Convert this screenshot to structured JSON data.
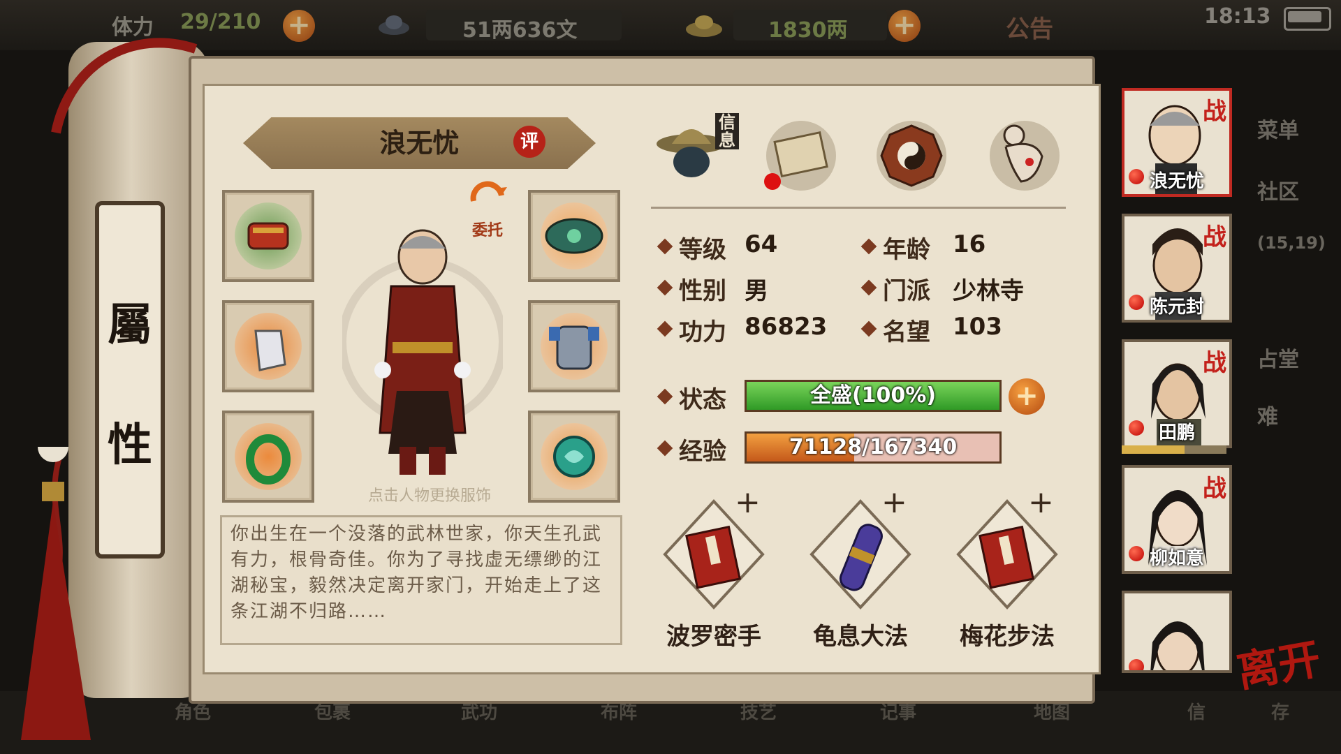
{
  "topbar": {
    "stamina_label": "体力",
    "stamina_value": "29/210",
    "silver": "51两636文",
    "gold": "1830两",
    "notice": "公告",
    "time": "18:13"
  },
  "scroll_tab": {
    "char1": "屬",
    "char2": "性"
  },
  "character": {
    "name": "浪无忧",
    "eval_badge": "评",
    "entrust": "委托",
    "hint": "点击人物更换服饰",
    "bio": "你出生在一个没落的武林世家，你天生孔武有力，根骨奇佳。你为了寻找虚无缥缈的江湖秘宝，毅然决定离开家门，开始走上了这条江湖不归路……"
  },
  "info_tabs": {
    "info_label": "信息"
  },
  "stats": {
    "level_label": "等级",
    "level": "64",
    "age_label": "年龄",
    "age": "16",
    "gender_label": "性别",
    "gender": "男",
    "sect_label": "门派",
    "sect": "少林寺",
    "power_label": "功力",
    "power": "86823",
    "fame_label": "名望",
    "fame": "103",
    "status_label": "状态",
    "status_text": "全盛(100%)",
    "status_fraction": 1.0,
    "exp_label": "经验",
    "exp_text": "71128/167340",
    "exp_fraction": 0.425
  },
  "skills": [
    {
      "name": "波罗密手"
    },
    {
      "name": "龟息大法"
    },
    {
      "name": "梅花步法"
    }
  ],
  "party": [
    {
      "name": "浪无忧",
      "tag": "战"
    },
    {
      "name": "陈元封",
      "tag": "战"
    },
    {
      "name": "田鹏",
      "tag": "战"
    },
    {
      "name": "柳如意",
      "tag": "战"
    },
    {
      "name": "",
      "tag": ""
    }
  ],
  "side_menu": {
    "menu": "菜单",
    "community": "社区",
    "coords": "(15,19)",
    "hall": "占堂",
    "hard": "难"
  },
  "leave": "离开",
  "bottom_nav": [
    {
      "label": "角色"
    },
    {
      "label": "包裹"
    },
    {
      "label": "武功"
    },
    {
      "label": "布阵"
    },
    {
      "label": "技艺"
    },
    {
      "label": "记事"
    },
    {
      "label": "地图"
    },
    {
      "label": "信"
    },
    {
      "label": "存"
    }
  ],
  "colors": {
    "accent_red": "#b62218",
    "status_green": "#46b13a",
    "exp_orange": "#e0781a",
    "paper": "#ebe2cf"
  }
}
